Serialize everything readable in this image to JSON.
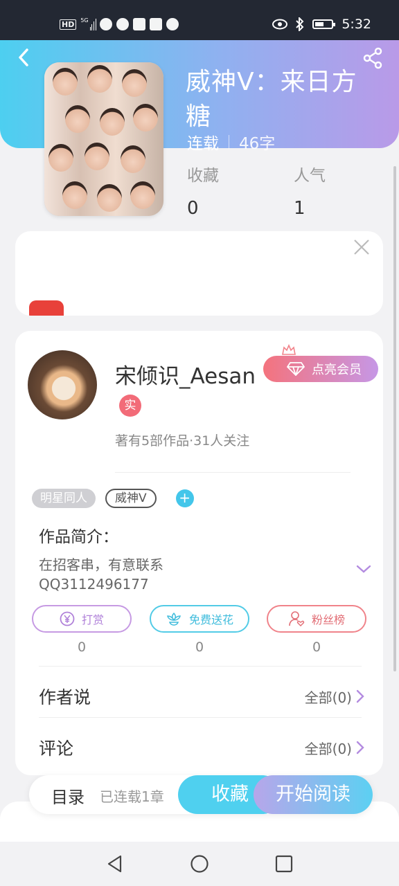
{
  "status_bar": {
    "hd_label": "HD",
    "signal_label": "5G",
    "time": "5:32"
  },
  "book": {
    "title": "威神V：来日方糖",
    "status": "连载",
    "word_count": "46字",
    "stats": [
      {
        "label": "收藏",
        "value": "0"
      },
      {
        "label": "人气",
        "value": "1"
      }
    ]
  },
  "author": {
    "name": "宋倾识_Aesan",
    "real_badge": "实",
    "works_info": "著有5部作品·31人关注",
    "vip_button": "点亮会员"
  },
  "tags": [
    "明星同人",
    "威神V"
  ],
  "tag_add_label": "+",
  "intro": {
    "label": "作品简介：",
    "text": "在招客串，有意联系\nQQ3112496177"
  },
  "actions": [
    {
      "label": "打赏",
      "count": "0",
      "icon": "yuan-coin-icon"
    },
    {
      "label": "免费送花",
      "count": "0",
      "icon": "flower-icon"
    },
    {
      "label": "粉丝榜",
      "count": "0",
      "icon": "user-heart-icon"
    }
  ],
  "sections": [
    {
      "title": "作者说",
      "more": "全部(0)"
    },
    {
      "title": "评论",
      "more": "全部(0)"
    }
  ],
  "bottom_bar": {
    "toc": "目录",
    "chapters": "已连载1章",
    "favorite": "收藏",
    "start_reading": "开始阅读"
  },
  "colors": {
    "header_gradient": [
      "#4dcff0",
      "#b99ae8"
    ],
    "vip_gradient": [
      "#f4737d",
      "#c697e6"
    ],
    "accent_cyan": "#4fd0ef"
  }
}
